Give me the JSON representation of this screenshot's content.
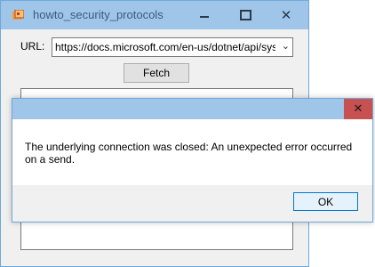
{
  "window": {
    "title": "howto_security_protocols",
    "icon": "app-form-icon",
    "minimize_icon": "minimize-icon",
    "maximize_icon": "maximize-icon",
    "close_glyph": "✕"
  },
  "form": {
    "url_label": "URL:",
    "url_value": "https://docs.microsoft.com/en-us/dotnet/api/system",
    "dropdown_glyph": "⌄",
    "fetch_label": "Fetch",
    "output_text": ""
  },
  "dialog": {
    "title": "",
    "close_glyph": "✕",
    "message": "The underlying connection was closed: An unexpected error occurred on a send.",
    "ok_label": "OK"
  },
  "colors": {
    "titlebar": "#9fc5e8",
    "dialog_close": "#c75050",
    "window_bg": "#f0f0f0"
  }
}
